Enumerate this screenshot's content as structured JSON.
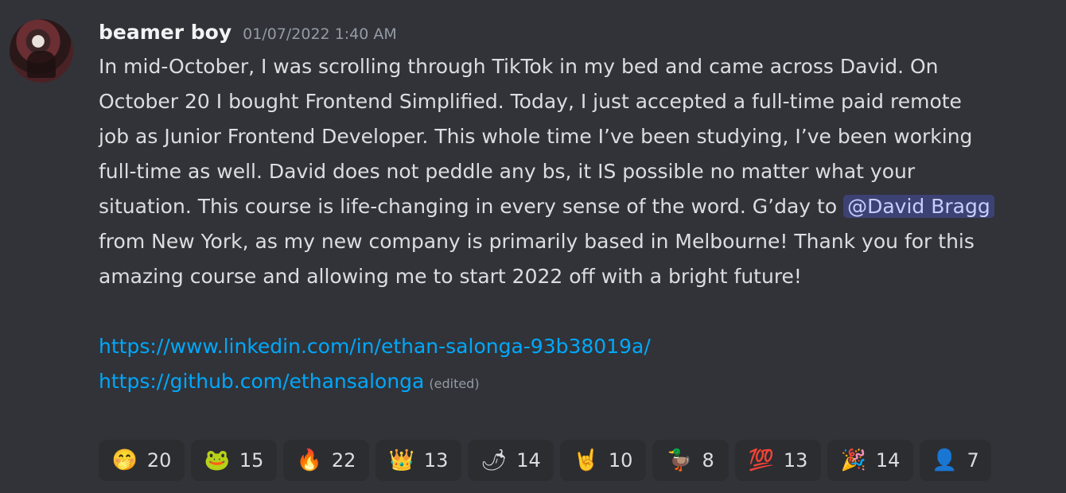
{
  "message": {
    "author": "beamer boy",
    "timestamp": "01/07/2022 1:40 AM",
    "text_before_mention": "In mid-October, I was scrolling through TikTok in my bed and came across David. On October 20 I bought Frontend Simplified. Today, I just accepted a full-time paid remote job as Junior Frontend Developer. This whole time I’ve been studying, I’ve been working full-time as well. David does not peddle any bs, it IS possible no matter what your situation. This course is life-changing in every sense of the word. G’day to",
    "mention": "@David Bragg",
    "text_after_mention": "from New York, as my new company is primarily based in Melbourne! Thank you for this amazing course and allowing me to start 2022 off with a bright future!",
    "links": [
      "https://www.linkedin.com/in/ethan-salonga-93b38019a/",
      "https://github.com/ethansalonga"
    ],
    "edited_label": "(edited)"
  },
  "reactions": [
    {
      "emoji": "🤭",
      "icon": "laughing-face-icon",
      "count": "20"
    },
    {
      "emoji": "🐸",
      "icon": "pepe-frog-icon",
      "count": "15"
    },
    {
      "emoji": "🔥",
      "icon": "fire-icon",
      "count": "22"
    },
    {
      "emoji": "👑",
      "icon": "crown-icon",
      "count": "13"
    },
    {
      "emoji": "🌶",
      "icon": "chili-pepper-icon",
      "count": "14"
    },
    {
      "emoji": "🤘",
      "icon": "rock-hand-icon",
      "count": "10"
    },
    {
      "emoji": "🦆",
      "icon": "duck-icon",
      "count": "8"
    },
    {
      "emoji": "💯",
      "icon": "hundred-points-icon",
      "count": "13"
    },
    {
      "emoji": "🎉",
      "icon": "party-popper-icon",
      "count": "14"
    },
    {
      "emoji": "👤",
      "icon": "avatar-emoji-icon",
      "count": "7"
    }
  ]
}
